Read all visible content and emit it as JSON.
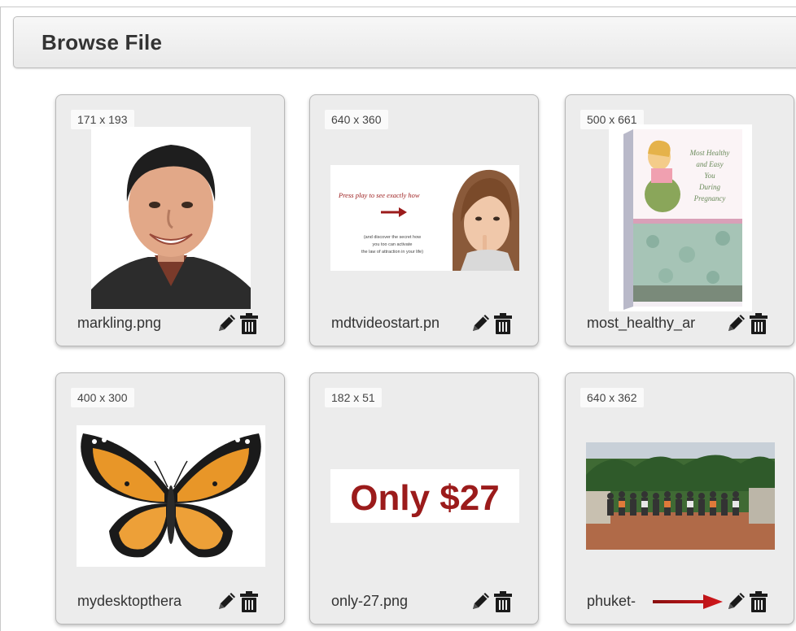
{
  "page": {
    "title": "Browse File"
  },
  "files": [
    {
      "dimensions": "171 x 193",
      "name": "markling.png",
      "thumb_icon": "portrait-photo"
    },
    {
      "dimensions": "640 x 360",
      "name": "mdtvideostart.pn",
      "thumb_icon": "video-start-banner",
      "thumb_text": {
        "headline": "Press play to see exactly how",
        "body_line1": "(and discover the secret how",
        "body_line2": "you too can activate",
        "body_line3": "the law of attraction in your life)"
      }
    },
    {
      "dimensions": "500 x 661",
      "name": "most_healthy_ar",
      "thumb_icon": "ebook-cover",
      "thumb_text": {
        "line1": "Most Healthy",
        "line2": "and Easy",
        "line3": "You",
        "line4": "During",
        "line5": "Pregnancy"
      }
    },
    {
      "dimensions": "400 x 300",
      "name": "mydesktopthera",
      "thumb_icon": "butterfly-image"
    },
    {
      "dimensions": "182 x 51",
      "name": "only-27.png",
      "thumb_icon": "price-banner",
      "thumb_text": {
        "price": "Only $27"
      }
    },
    {
      "dimensions": "640 x 362",
      "name": "phuket-",
      "thumb_icon": "group-photo"
    }
  ],
  "actions": {
    "edit_icon": "pencil-icon",
    "delete_icon": "trash-icon"
  },
  "annotation": {
    "arrow_color": "#c0151a",
    "points_to": "edit-button"
  },
  "colors": {
    "header_bg": "#eeeeee",
    "card_bg": "#ececec",
    "price_red": "#9b1b1b"
  }
}
